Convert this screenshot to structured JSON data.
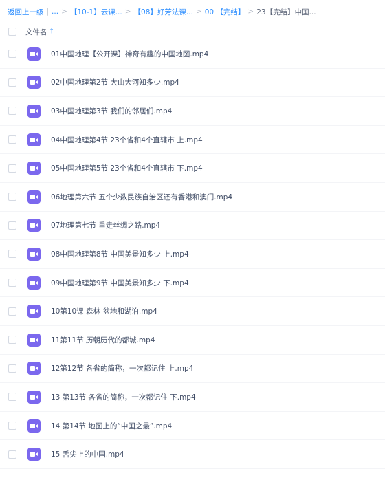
{
  "breadcrumb": {
    "back": "返回上一级",
    "divider": "|",
    "ellipsis": "...",
    "sep": ">",
    "crumbs": [
      "【10-1】云课...",
      "【08】好芳法课...",
      "00 【完结】"
    ],
    "current": "23【完结】中国..."
  },
  "list_header": {
    "column_label": "文件名",
    "sort_icon": "arrow-up-icon"
  },
  "file_icon": "video-file-icon",
  "colors": {
    "accent": "#2f8fff",
    "video_icon": "#7b68ee"
  },
  "files": [
    "01中国地理【公开课】神奇有趣的中国地图.mp4",
    "02中国地理第2节 大山大河知多少.mp4",
    "03中国地理第3节 我们的邻居们.mp4",
    "04中国地理第4节 23个省和4个直辖市 上.mp4",
    "05中国地理第5节 23个省和4个直辖市 下.mp4",
    "06地理第六节 五个少数民族自治区还有香港和澳门.mp4",
    "07地理第七节 重走丝绸之路.mp4",
    "08中国地理第8节 中国美景知多少 上.mp4",
    "09中国地理第9节 中国美景知多少 下.mp4",
    "10第10课 森林 盆地和湖泊.mp4",
    "11第11节 历朝历代的都城.mp4",
    "12第12节 各省的简称，一次都记住 上.mp4",
    "13 第13节 各省的简称，一次都记住 下.mp4",
    "14 第14节 地图上的“中国之最”.mp4",
    "15 舌尖上的中国.mp4"
  ]
}
